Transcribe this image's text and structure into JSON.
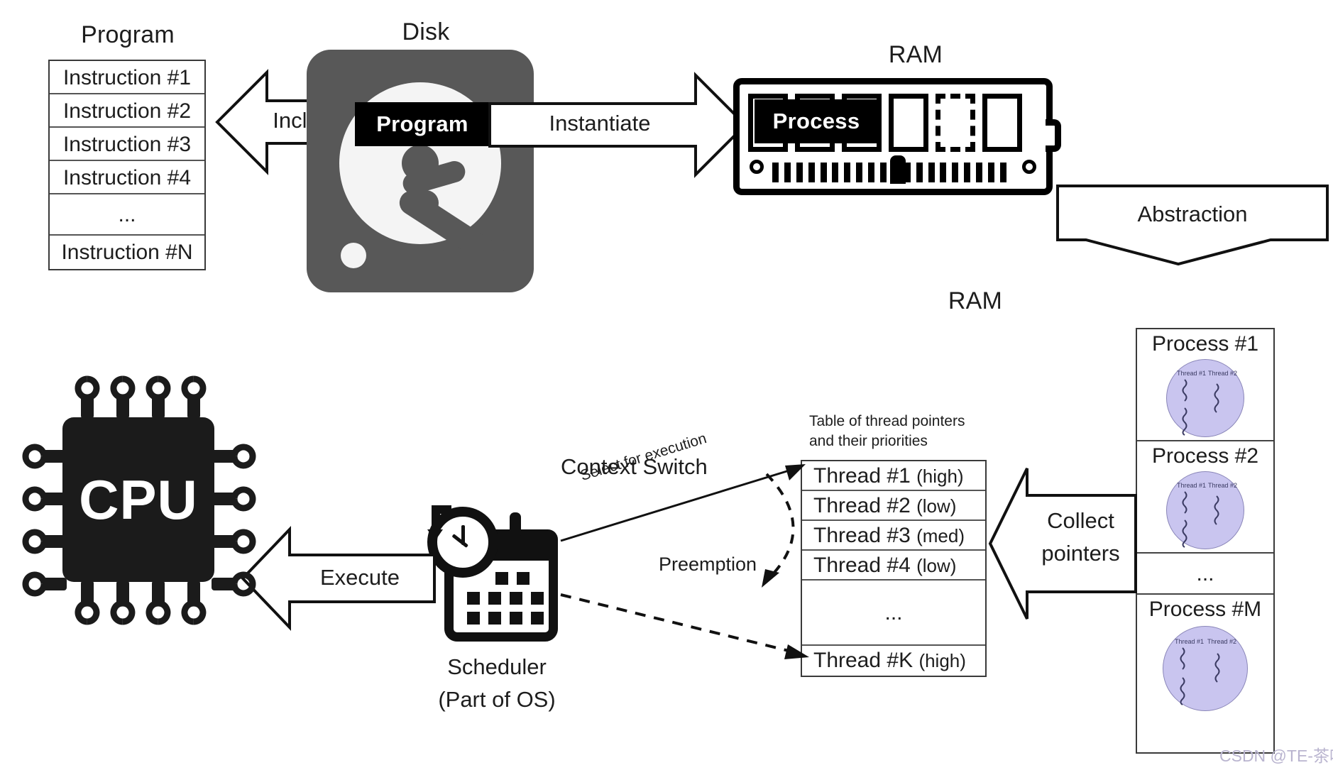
{
  "diagram": {
    "title_program": "Program",
    "title_disk": "Disk",
    "title_ram_top": "RAM",
    "title_ram_bottom": "RAM"
  },
  "program_table": {
    "rows": [
      "Instruction #1",
      "Instruction #2",
      "Instruction #3",
      "Instruction #4",
      "...",
      "Instruction #N"
    ]
  },
  "chips": {
    "program": "Program",
    "process": "Process"
  },
  "arrows": {
    "includes": "Includes",
    "instantiate": "Instantiate",
    "abstraction": "Abstraction",
    "execute": "Execute",
    "collect_pointers_line1": "Collect",
    "collect_pointers_line2": "pointers"
  },
  "scheduler": {
    "label_line1": "Scheduler",
    "label_line2": "(Part of OS)",
    "context_switch": "Context Switch",
    "select_for_execution": "Select for execution",
    "preemption": "Preemption"
  },
  "cpu": {
    "label": "CPU"
  },
  "thread_table": {
    "caption_line1": "Table of thread pointers",
    "caption_line2": "and their priorities",
    "rows": [
      {
        "name": "Thread #1",
        "priority": "(high)"
      },
      {
        "name": "Thread #2",
        "priority": "(low)"
      },
      {
        "name": "Thread #3",
        "priority": "(med)"
      },
      {
        "name": "Thread #4",
        "priority": "(low)"
      },
      {
        "name": "...",
        "priority": ""
      },
      {
        "name": "Thread #K",
        "priority": "(high)"
      }
    ]
  },
  "process_stack": {
    "cells": [
      {
        "name": "Process #1",
        "thread_a": "Thread #1",
        "thread_b": "Thread #2"
      },
      {
        "name": "Process #2",
        "thread_a": "Thread #1",
        "thread_b": "Thread #2"
      },
      {
        "name": "...",
        "thread_a": "",
        "thread_b": ""
      },
      {
        "name": "Process #M",
        "thread_a": "Thread #1",
        "thread_b": "Thread #2"
      }
    ]
  },
  "watermark": {
    "text": "CSDN @TE-茶叶蛋"
  },
  "colors": {
    "ink": "#1d1d1d",
    "disk_gray": "#585858",
    "thread_bubble": "#c9c5ef",
    "chip_black": "#000000",
    "watermark": "#b9b4cf"
  }
}
